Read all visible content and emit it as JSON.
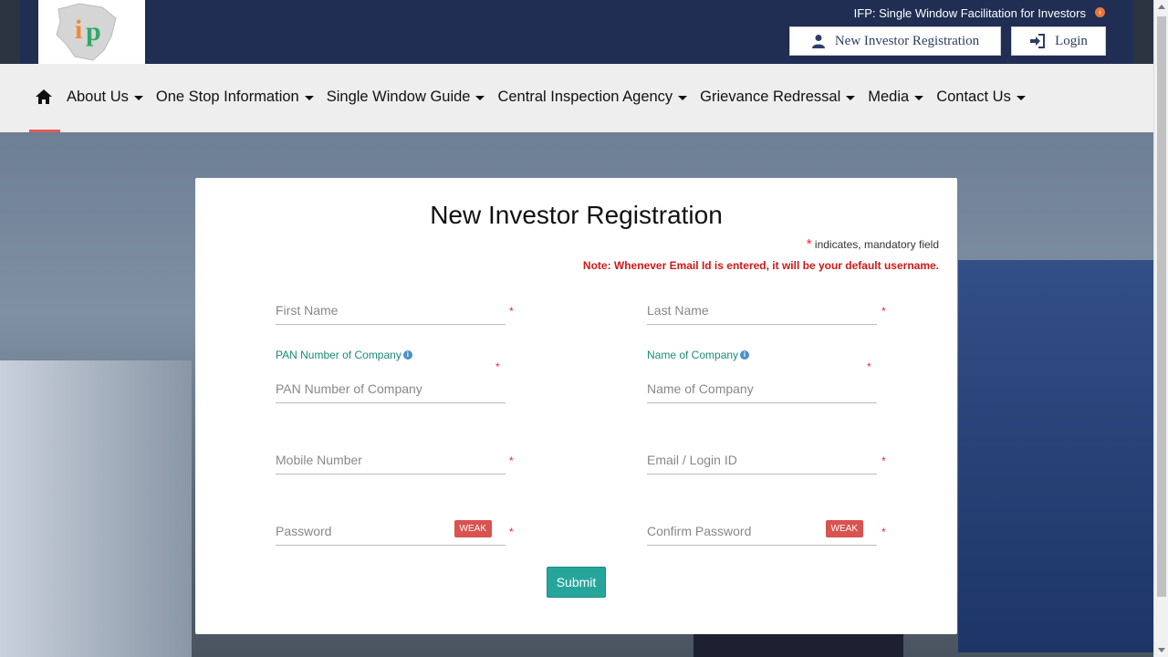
{
  "header": {
    "site_title": "IFP: Single Window Facilitation for Investors",
    "register_label": "New Investor Registration",
    "login_label": "Login",
    "logo_text": "ifp"
  },
  "nav": {
    "items": [
      {
        "label": "About Us"
      },
      {
        "label": "One Stop Information"
      },
      {
        "label": "Single Window Guide"
      },
      {
        "label": "Central Inspection Agency"
      },
      {
        "label": "Grievance Redressal"
      },
      {
        "label": "Media"
      },
      {
        "label": "Contact Us"
      }
    ]
  },
  "form": {
    "title": "New Investor Registration",
    "mandatory_note": "indicates, mandatory field",
    "mandatory_star": "*",
    "email_note": "Note: Whenever Email Id is entered, it will be your default username.",
    "first_name_placeholder": "First Name",
    "last_name_placeholder": "Last Name",
    "pan_label": "PAN Number of Company",
    "pan_placeholder": "PAN Number of Company",
    "company_label": "Name of Company",
    "company_placeholder": "Name of Company",
    "mobile_placeholder": "Mobile Number",
    "email_placeholder": "Email / Login ID",
    "password_placeholder": "Password",
    "confirm_password_placeholder": "Confirm Password",
    "strength": "WEAK",
    "submit_label": "Submit"
  },
  "colors": {
    "header_bg": "#1f2e52",
    "accent_teal": "#26a69a",
    "required_red": "#e22233",
    "weak_badge": "#d9534f"
  }
}
